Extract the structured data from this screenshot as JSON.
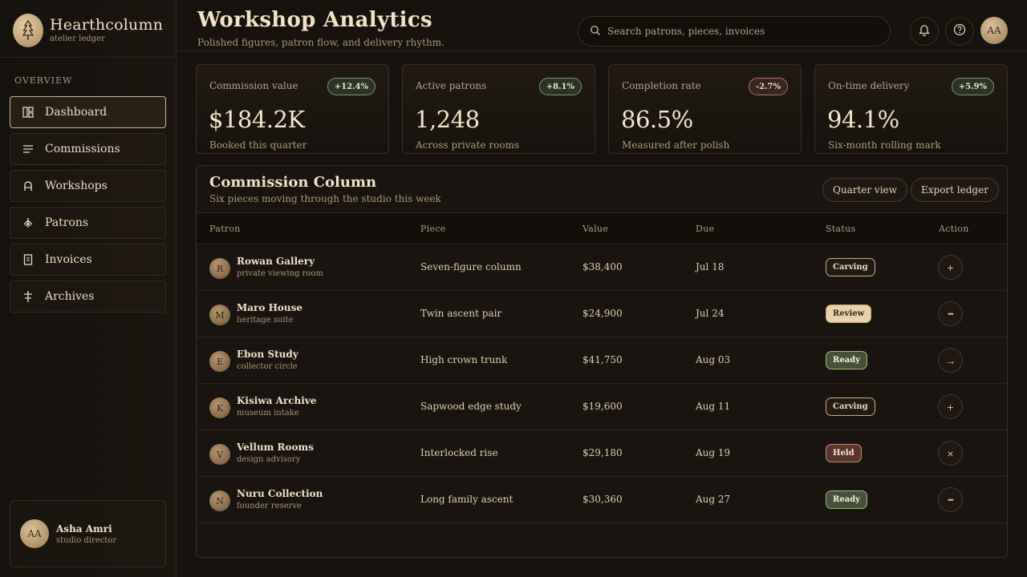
{
  "brand": {
    "name": "Hearthcolumn",
    "subtitle": "atelier ledger"
  },
  "sidebar": {
    "section_label": "OVERVIEW",
    "items": [
      {
        "label": "Dashboard",
        "icon": "dashboard-icon",
        "active": true
      },
      {
        "label": "Commissions",
        "icon": "list-icon",
        "active": false
      },
      {
        "label": "Workshops",
        "icon": "arch-icon",
        "active": false
      },
      {
        "label": "Patrons",
        "icon": "tree-icon",
        "active": false
      },
      {
        "label": "Invoices",
        "icon": "document-icon",
        "active": false
      },
      {
        "label": "Archives",
        "icon": "archive-icon",
        "active": false
      }
    ],
    "profile": {
      "initials": "AA",
      "name": "Asha Amri",
      "role": "studio director"
    }
  },
  "header": {
    "title": "Workshop Analytics",
    "subtitle": "Polished figures, patron flow, and delivery rhythm.",
    "search_placeholder": "Search patrons, pieces, invoices",
    "avatar_initials": "AA"
  },
  "kpis": [
    {
      "label": "Commission value",
      "badge": "+12.4%",
      "trend": "up",
      "value": "$184.2K",
      "note": "Booked this quarter"
    },
    {
      "label": "Active patrons",
      "badge": "+8.1%",
      "trend": "up",
      "value": "1,248",
      "note": "Across private rooms"
    },
    {
      "label": "Completion rate",
      "badge": "-2.7%",
      "trend": "down",
      "value": "86.5%",
      "note": "Measured after polish"
    },
    {
      "label": "On-time delivery",
      "badge": "+5.9%",
      "trend": "up",
      "value": "94.1%",
      "note": "Six-month rolling mark"
    }
  ],
  "table": {
    "title": "Commission Column",
    "subtitle": "Six pieces moving through the studio this week",
    "quarter_button": "Quarter view",
    "export_button": "Export ledger",
    "columns": [
      "Patron",
      "Piece",
      "Value",
      "Due",
      "Status",
      "Action"
    ],
    "rows": [
      {
        "initial": "R",
        "patron": "Rowan Gallery",
        "patron_sub": "private viewing room",
        "piece": "Seven-figure column",
        "value": "$38,400",
        "due": "Jul 18",
        "status": "Carving",
        "action": "+"
      },
      {
        "initial": "M",
        "patron": "Maro House",
        "patron_sub": "heritage suite",
        "piece": "Twin ascent pair",
        "value": "$24,900",
        "due": "Jul 24",
        "status": "Review",
        "action": "•••"
      },
      {
        "initial": "E",
        "patron": "Ebon Study",
        "patron_sub": "collector circle",
        "piece": "High crown trunk",
        "value": "$41,750",
        "due": "Aug 03",
        "status": "Ready",
        "action": "→"
      },
      {
        "initial": "K",
        "patron": "Kisiwa Archive",
        "patron_sub": "museum intake",
        "piece": "Sapwood edge study",
        "value": "$19,600",
        "due": "Aug 11",
        "status": "Carving",
        "action": "+"
      },
      {
        "initial": "V",
        "patron": "Vellum Rooms",
        "patron_sub": "design advisory",
        "piece": "Interlocked rise",
        "value": "$29,180",
        "due": "Aug 19",
        "status": "Held",
        "action": "×"
      },
      {
        "initial": "N",
        "patron": "Nuru Collection",
        "patron_sub": "founder reserve",
        "piece": "Long family ascent",
        "value": "$30,360",
        "due": "Aug 27",
        "status": "Ready",
        "action": "•••"
      }
    ]
  }
}
